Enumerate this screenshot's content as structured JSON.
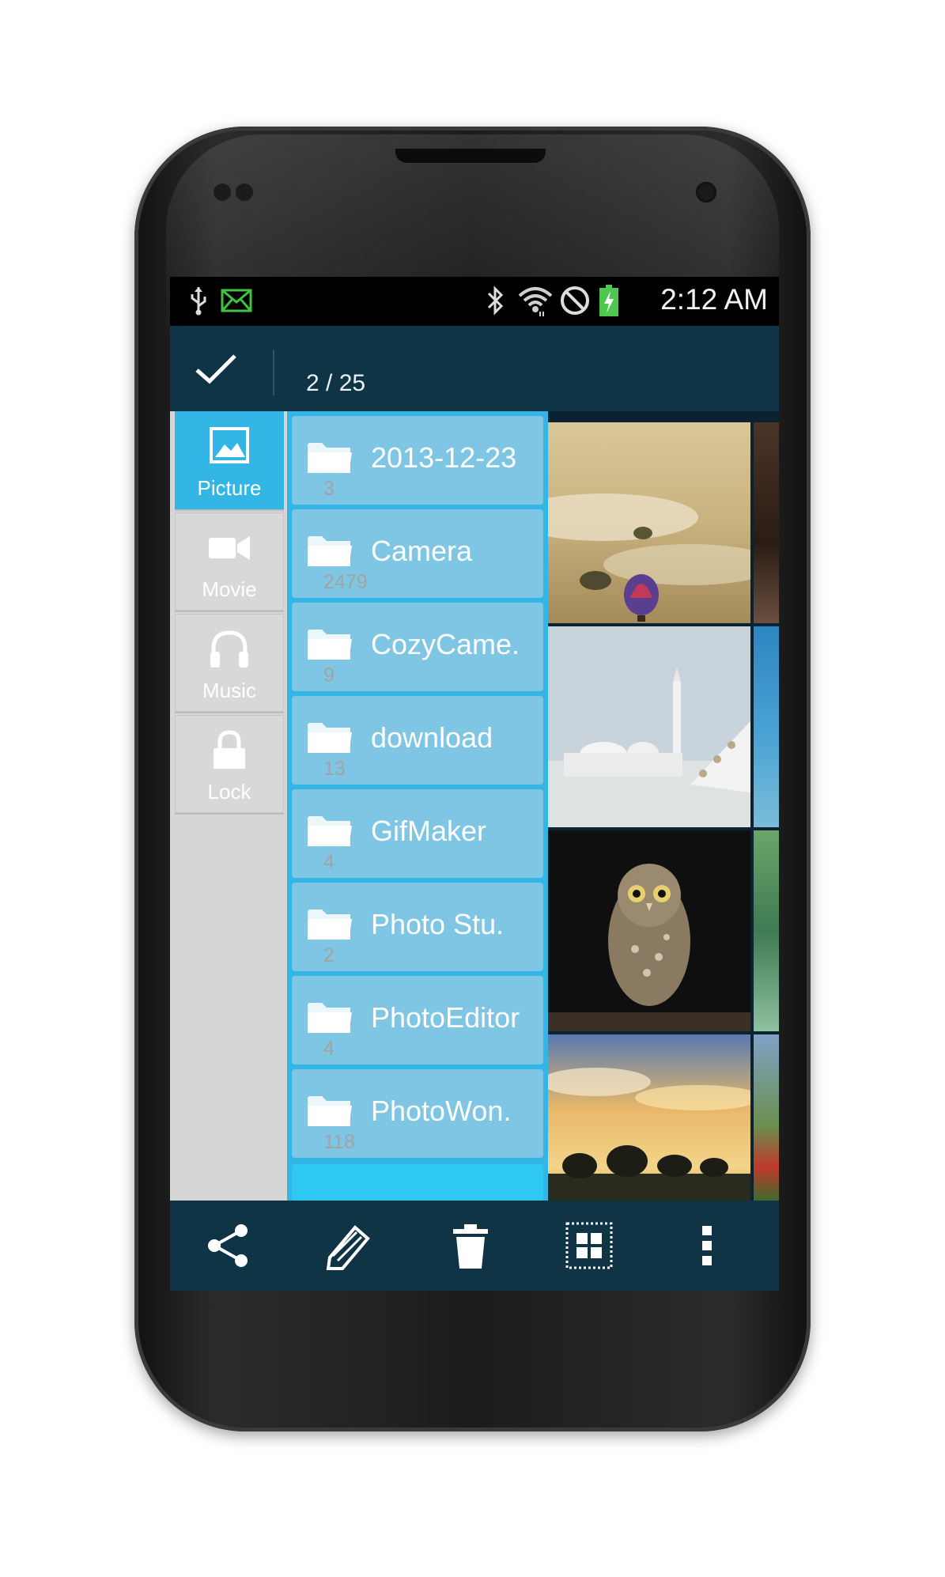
{
  "status_bar": {
    "time": "2:12 AM",
    "left_icons": [
      "usb-icon",
      "mail-icon"
    ],
    "right_icons": [
      "bluetooth-icon",
      "wifi-icon",
      "no-signal-icon",
      "battery-charging-icon"
    ]
  },
  "action_bar": {
    "done_icon": "check-icon",
    "selection_count": "2 / 25"
  },
  "tabs": [
    {
      "label": "Picture",
      "icon": "picture-icon",
      "active": true
    },
    {
      "label": "Movie",
      "icon": "video-camera-icon",
      "active": false
    },
    {
      "label": "Music",
      "icon": "headphones-icon",
      "active": false
    },
    {
      "label": "Lock",
      "icon": "lock-icon",
      "active": false
    }
  ],
  "folders": [
    {
      "name": "2013-12-23",
      "count": "3"
    },
    {
      "name": "Camera",
      "count": "2479"
    },
    {
      "name": "CozyCame.",
      "count": "9"
    },
    {
      "name": "download",
      "count": "13"
    },
    {
      "name": "GifMaker",
      "count": "4"
    },
    {
      "name": "Photo Stu.",
      "count": "2"
    },
    {
      "name": "PhotoEditor",
      "count": "4"
    },
    {
      "name": "PhotoWon.",
      "count": "118"
    }
  ],
  "photos": [
    "hot-air-balloon-fog",
    "mosque-arches",
    "owl",
    "sunset-trees"
  ],
  "bottom_bar": [
    "share-icon",
    "edit-icon",
    "delete-icon",
    "select-all-icon",
    "overflow-menu-icon"
  ],
  "colors": {
    "accent": "#33b5e5",
    "action_bar": "#0f3446",
    "folder_item": "#7fc5e4",
    "tab_inactive": "#d8d8d8"
  }
}
